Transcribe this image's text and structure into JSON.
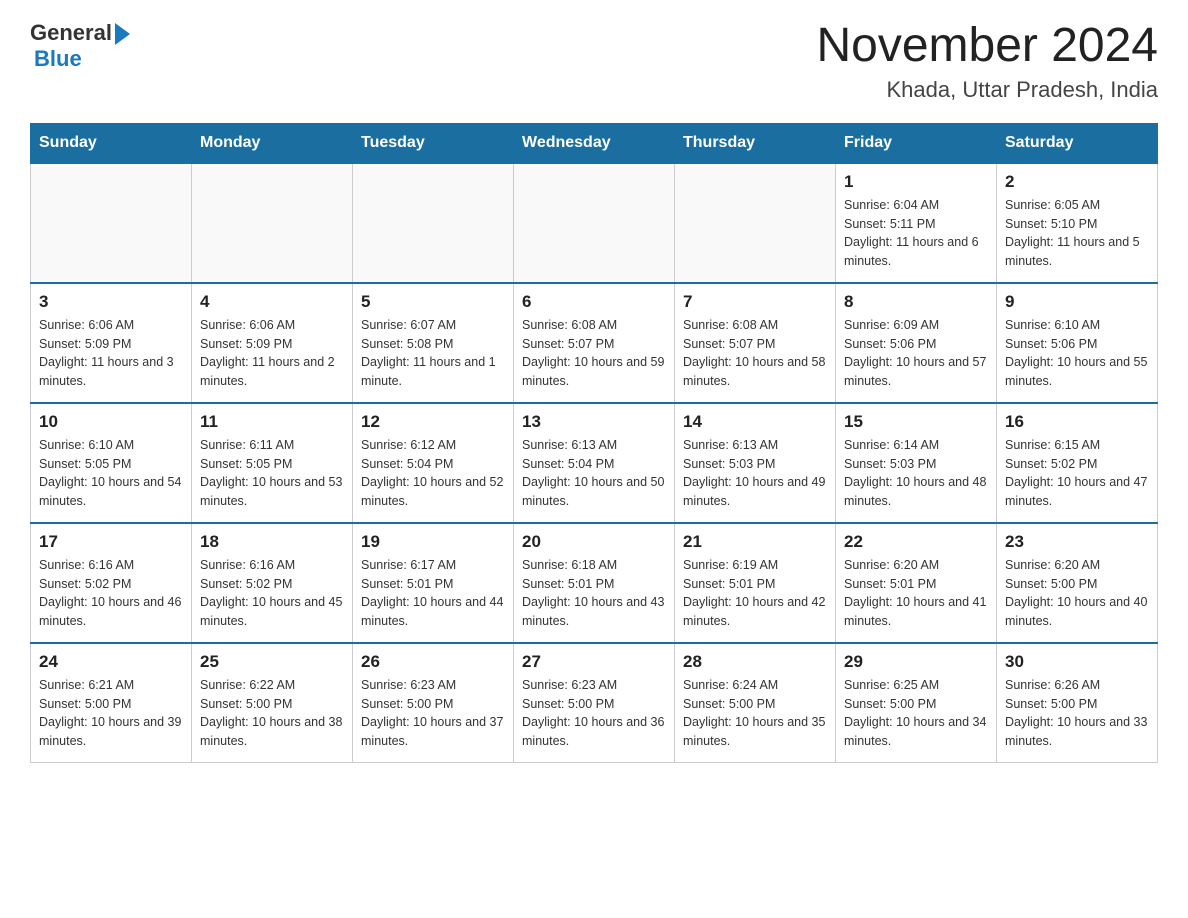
{
  "header": {
    "title": "November 2024",
    "subtitle": "Khada, Uttar Pradesh, India",
    "logo": {
      "general": "General",
      "blue": "Blue"
    }
  },
  "days_of_week": [
    "Sunday",
    "Monday",
    "Tuesday",
    "Wednesday",
    "Thursday",
    "Friday",
    "Saturday"
  ],
  "weeks": [
    [
      {
        "day": "",
        "info": ""
      },
      {
        "day": "",
        "info": ""
      },
      {
        "day": "",
        "info": ""
      },
      {
        "day": "",
        "info": ""
      },
      {
        "day": "",
        "info": ""
      },
      {
        "day": "1",
        "info": "Sunrise: 6:04 AM\nSunset: 5:11 PM\nDaylight: 11 hours and 6 minutes."
      },
      {
        "day": "2",
        "info": "Sunrise: 6:05 AM\nSunset: 5:10 PM\nDaylight: 11 hours and 5 minutes."
      }
    ],
    [
      {
        "day": "3",
        "info": "Sunrise: 6:06 AM\nSunset: 5:09 PM\nDaylight: 11 hours and 3 minutes."
      },
      {
        "day": "4",
        "info": "Sunrise: 6:06 AM\nSunset: 5:09 PM\nDaylight: 11 hours and 2 minutes."
      },
      {
        "day": "5",
        "info": "Sunrise: 6:07 AM\nSunset: 5:08 PM\nDaylight: 11 hours and 1 minute."
      },
      {
        "day": "6",
        "info": "Sunrise: 6:08 AM\nSunset: 5:07 PM\nDaylight: 10 hours and 59 minutes."
      },
      {
        "day": "7",
        "info": "Sunrise: 6:08 AM\nSunset: 5:07 PM\nDaylight: 10 hours and 58 minutes."
      },
      {
        "day": "8",
        "info": "Sunrise: 6:09 AM\nSunset: 5:06 PM\nDaylight: 10 hours and 57 minutes."
      },
      {
        "day": "9",
        "info": "Sunrise: 6:10 AM\nSunset: 5:06 PM\nDaylight: 10 hours and 55 minutes."
      }
    ],
    [
      {
        "day": "10",
        "info": "Sunrise: 6:10 AM\nSunset: 5:05 PM\nDaylight: 10 hours and 54 minutes."
      },
      {
        "day": "11",
        "info": "Sunrise: 6:11 AM\nSunset: 5:05 PM\nDaylight: 10 hours and 53 minutes."
      },
      {
        "day": "12",
        "info": "Sunrise: 6:12 AM\nSunset: 5:04 PM\nDaylight: 10 hours and 52 minutes."
      },
      {
        "day": "13",
        "info": "Sunrise: 6:13 AM\nSunset: 5:04 PM\nDaylight: 10 hours and 50 minutes."
      },
      {
        "day": "14",
        "info": "Sunrise: 6:13 AM\nSunset: 5:03 PM\nDaylight: 10 hours and 49 minutes."
      },
      {
        "day": "15",
        "info": "Sunrise: 6:14 AM\nSunset: 5:03 PM\nDaylight: 10 hours and 48 minutes."
      },
      {
        "day": "16",
        "info": "Sunrise: 6:15 AM\nSunset: 5:02 PM\nDaylight: 10 hours and 47 minutes."
      }
    ],
    [
      {
        "day": "17",
        "info": "Sunrise: 6:16 AM\nSunset: 5:02 PM\nDaylight: 10 hours and 46 minutes."
      },
      {
        "day": "18",
        "info": "Sunrise: 6:16 AM\nSunset: 5:02 PM\nDaylight: 10 hours and 45 minutes."
      },
      {
        "day": "19",
        "info": "Sunrise: 6:17 AM\nSunset: 5:01 PM\nDaylight: 10 hours and 44 minutes."
      },
      {
        "day": "20",
        "info": "Sunrise: 6:18 AM\nSunset: 5:01 PM\nDaylight: 10 hours and 43 minutes."
      },
      {
        "day": "21",
        "info": "Sunrise: 6:19 AM\nSunset: 5:01 PM\nDaylight: 10 hours and 42 minutes."
      },
      {
        "day": "22",
        "info": "Sunrise: 6:20 AM\nSunset: 5:01 PM\nDaylight: 10 hours and 41 minutes."
      },
      {
        "day": "23",
        "info": "Sunrise: 6:20 AM\nSunset: 5:00 PM\nDaylight: 10 hours and 40 minutes."
      }
    ],
    [
      {
        "day": "24",
        "info": "Sunrise: 6:21 AM\nSunset: 5:00 PM\nDaylight: 10 hours and 39 minutes."
      },
      {
        "day": "25",
        "info": "Sunrise: 6:22 AM\nSunset: 5:00 PM\nDaylight: 10 hours and 38 minutes."
      },
      {
        "day": "26",
        "info": "Sunrise: 6:23 AM\nSunset: 5:00 PM\nDaylight: 10 hours and 37 minutes."
      },
      {
        "day": "27",
        "info": "Sunrise: 6:23 AM\nSunset: 5:00 PM\nDaylight: 10 hours and 36 minutes."
      },
      {
        "day": "28",
        "info": "Sunrise: 6:24 AM\nSunset: 5:00 PM\nDaylight: 10 hours and 35 minutes."
      },
      {
        "day": "29",
        "info": "Sunrise: 6:25 AM\nSunset: 5:00 PM\nDaylight: 10 hours and 34 minutes."
      },
      {
        "day": "30",
        "info": "Sunrise: 6:26 AM\nSunset: 5:00 PM\nDaylight: 10 hours and 33 minutes."
      }
    ]
  ]
}
